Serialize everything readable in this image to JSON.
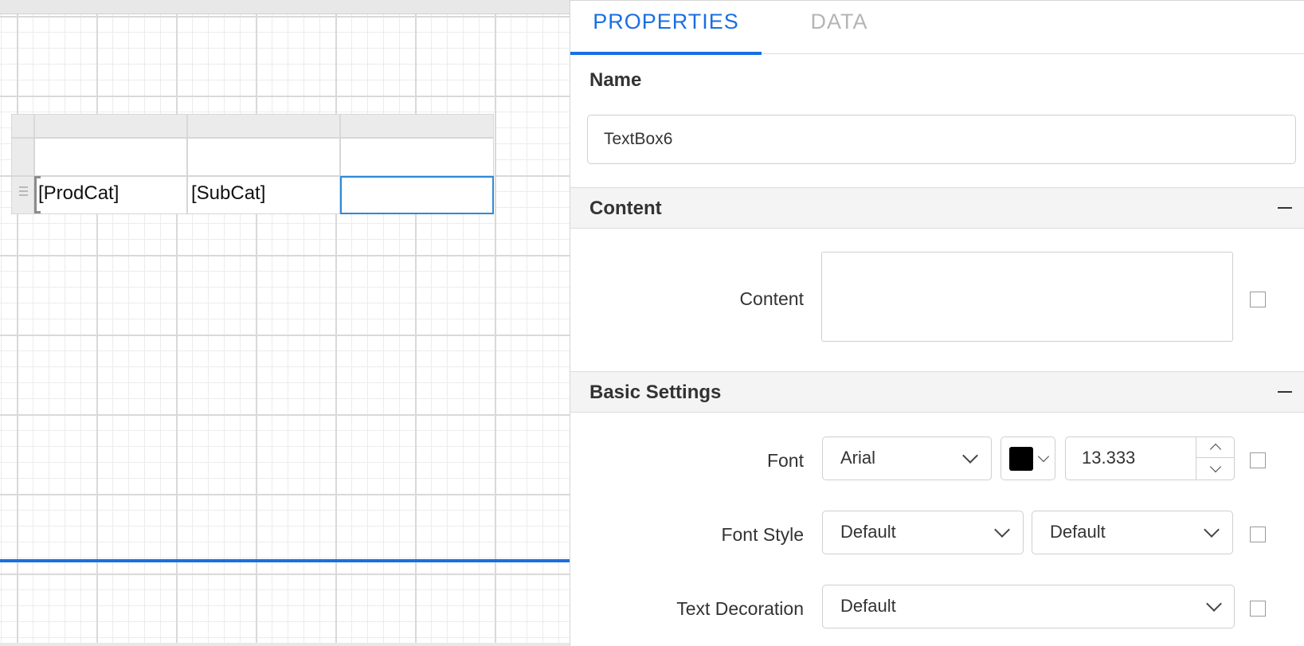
{
  "canvas": {
    "tablix": {
      "rows": [
        {
          "cells": [
            "",
            "",
            ""
          ]
        },
        {
          "cells": [
            "[ProdCat]",
            "[SubCat]",
            ""
          ]
        }
      ]
    },
    "footer_line_color": "#1a6fe0",
    "selection_color": "#2b8ad8"
  },
  "panel": {
    "tabs": [
      {
        "label": "PROPERTIES",
        "active": true
      },
      {
        "label": "DATA",
        "active": false
      }
    ],
    "name": {
      "label": "Name",
      "value": "TextBox6"
    },
    "sections": {
      "content": {
        "title": "Content",
        "collapse_icon": "minus-icon",
        "content_label": "Content",
        "content_value": ""
      },
      "basic": {
        "title": "Basic Settings",
        "collapse_icon": "minus-icon",
        "font_label": "Font",
        "font_family": "Arial",
        "font_color": "#000000",
        "font_size": "13.333",
        "font_style_label": "Font Style",
        "font_style": "Default",
        "font_weight": "Default",
        "text_decoration_label": "Text Decoration",
        "text_decoration": "Default"
      }
    }
  },
  "colors": {
    "accent": "#1a6fe0",
    "inactive_tab": "#b5b5b5"
  }
}
